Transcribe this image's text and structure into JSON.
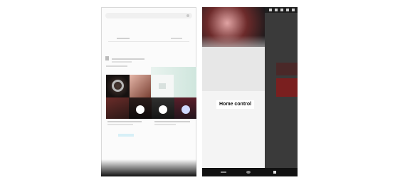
{
  "right_screen": {
    "home_control_label": "Home control"
  },
  "colors": {
    "page_background": "#ffffff",
    "left_screen_background": "#fbfbfb",
    "right_screen_background": "#e7e7e7",
    "side_pane_dark": "#3a3a3a",
    "nav_bar": "#111111",
    "accent_mint": "#cfe6dd",
    "accent_red": "#7a1f1f"
  },
  "icons": [
    "play-icon",
    "back-nav-icon",
    "home-nav-icon",
    "recents-nav-icon",
    "status-icon"
  ]
}
